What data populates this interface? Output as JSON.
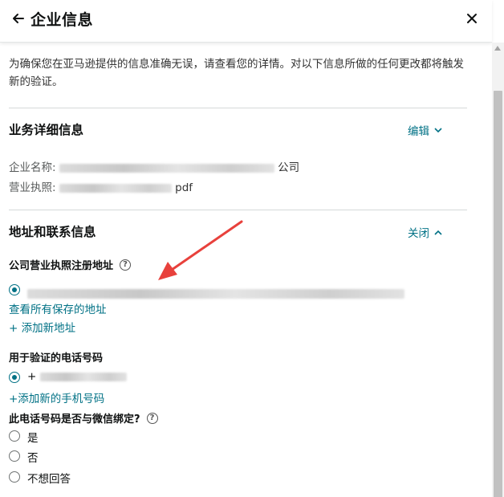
{
  "header": {
    "title": "企业信息",
    "back_icon": "arrow-left-icon",
    "close_icon": "close-icon"
  },
  "intro": "为确保您在亚马逊提供的信息准确无误，请查看您的详情。对以下信息所做的任何更改都将触发新的验证。",
  "business": {
    "title": "业务详细信息",
    "action": "编辑",
    "company_label": "企业名称:",
    "company_value_visible": "公司",
    "license_label": "营业执照:",
    "license_value_visible": "pdf"
  },
  "address": {
    "title": "地址和联系信息",
    "action": "关闭",
    "registered_address_label": "公司营业执照注册地址",
    "view_saved_addresses": "查看所有保存的地址",
    "add_address": "+ 添加新地址",
    "phone_label": "用于验证的电话号码",
    "phone_prefix": "+",
    "add_phone": "+添加新的手机号码",
    "wechat_question": "此电话号码是否与微信绑定?",
    "wechat_options": [
      "是",
      "否",
      "不想回答"
    ]
  },
  "colors": {
    "link": "#007185",
    "annotation_arrow": "#e8413c",
    "text": "#0f1111"
  }
}
